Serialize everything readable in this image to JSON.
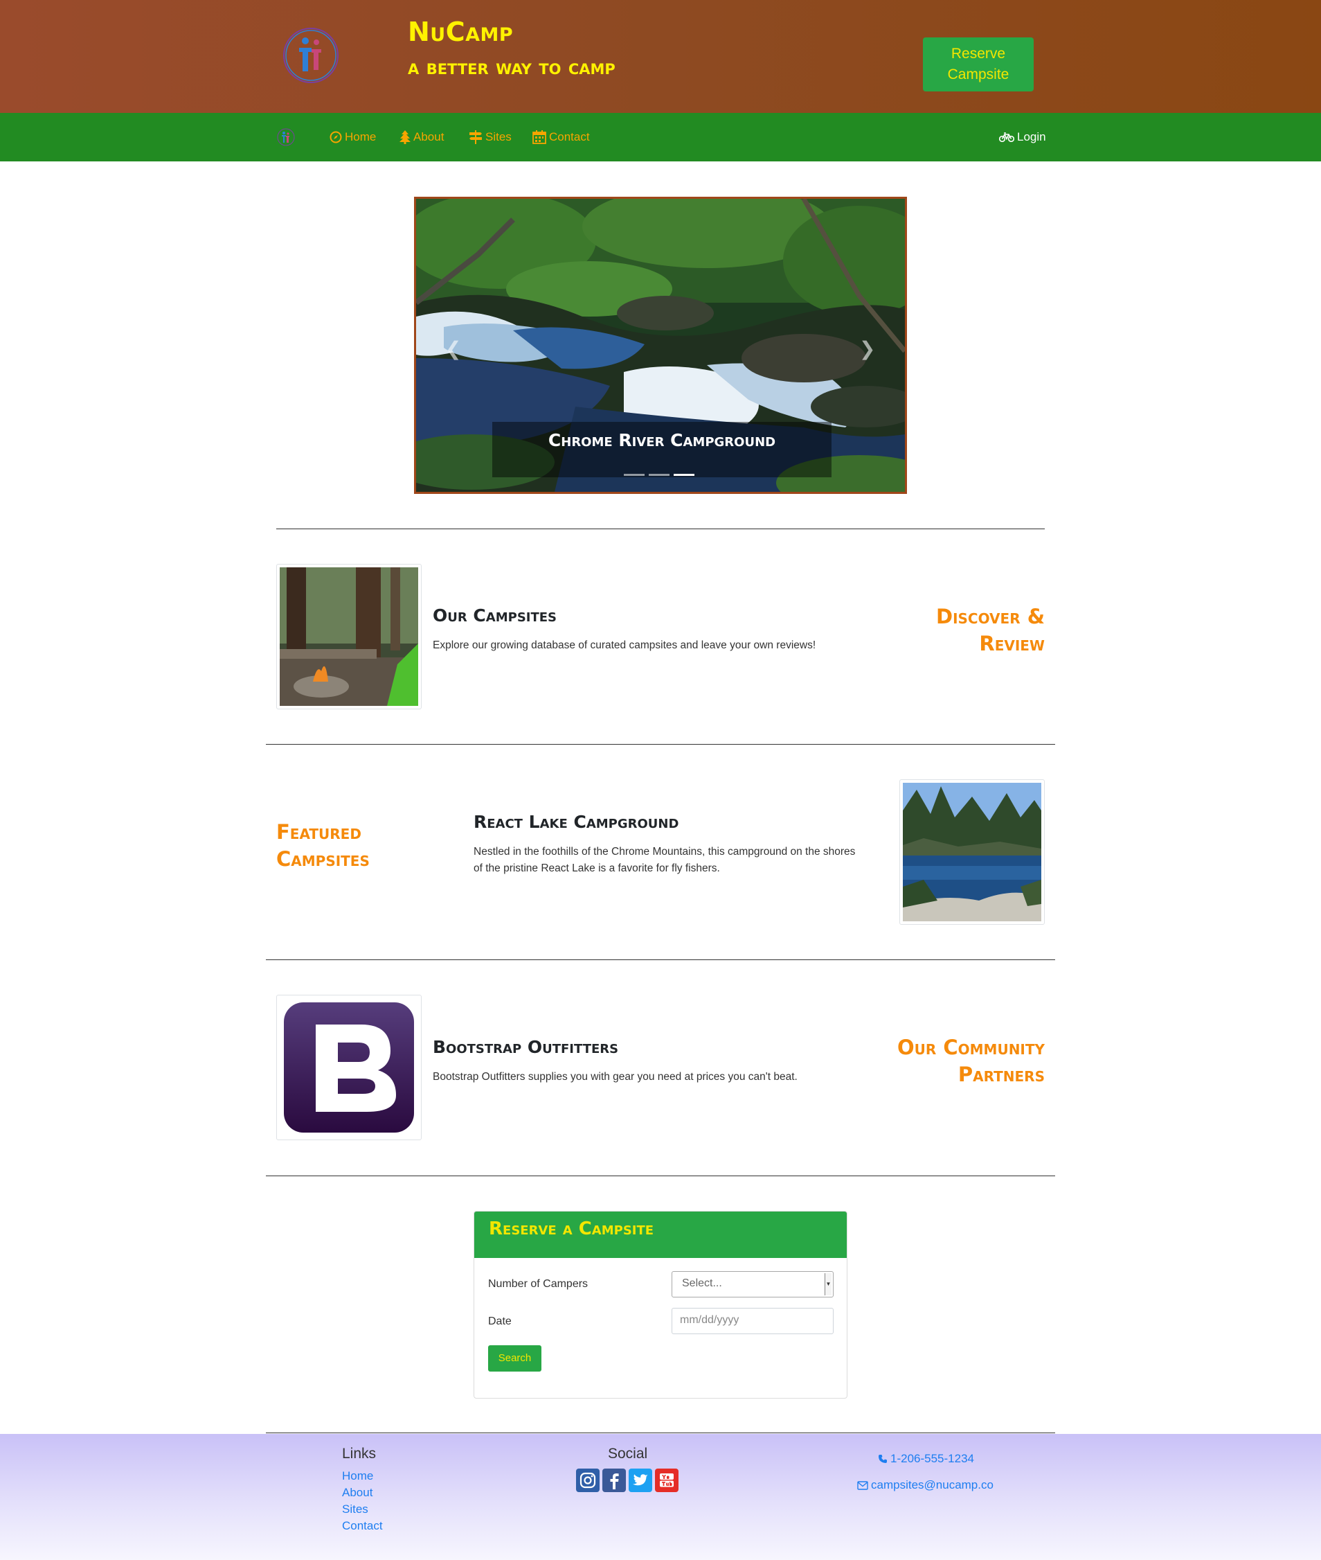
{
  "header": {
    "brand_title": "NuCamp",
    "brand_subtitle": "a better way to camp",
    "reserve_button": "Reserve\nCampsite"
  },
  "nav": {
    "items": [
      {
        "label": "Home",
        "icon": "compass-icon"
      },
      {
        "label": "About",
        "icon": "tree-icon"
      },
      {
        "label": "Sites",
        "icon": "signs-icon"
      },
      {
        "label": "Contact",
        "icon": "calendar-icon"
      }
    ],
    "login": "Login",
    "login_icon": "bicycle-icon"
  },
  "carousel": {
    "caption": "Chrome River Campground",
    "slide_count": 3,
    "active_slide": 3
  },
  "sections": [
    {
      "title": "Our Campsites",
      "text": "Explore our growing database of curated campsites and leave your own reviews!",
      "side_heading_1": "Discover &",
      "side_heading_2": "Review"
    },
    {
      "title": "React Lake Campground",
      "text_1": "Nestled in the foothills of the Chrome Mountains, this campground on the shores",
      "text_2": "of the pristine React Lake is a favorite for fly fishers.",
      "side_heading_1": "Featured",
      "side_heading_2": "Campsites"
    },
    {
      "title": "Bootstrap Outfitters",
      "text": "Bootstrap Outfitters supplies you with gear you need at prices you can't beat.",
      "side_heading_1": "Our Community",
      "side_heading_2": "Partners"
    }
  ],
  "reserve_form": {
    "title": "Reserve a Campsite",
    "campers_label": "Number of Campers",
    "campers_value": "Select...",
    "date_label": "Date",
    "date_placeholder": "mm/dd/yyyy",
    "search_button": "Search"
  },
  "footer": {
    "links_heading": "Links",
    "links": [
      "Home",
      "About",
      "Sites",
      "Contact"
    ],
    "social_heading": "Social",
    "social": [
      "instagram-icon",
      "facebook-icon",
      "twitter-icon",
      "youtube-icon"
    ],
    "phone": "1-206-555-1234",
    "email": "campsites@nucamp.co"
  },
  "colors": {
    "header_bg": "#8e4a22",
    "nav_bg": "#228b22",
    "brand_yellow": "#fff200",
    "accent_green": "#28a745",
    "orange_heading": "#f58a0b",
    "link_blue": "#1e7ef0",
    "footer_bg": "#d6d0f9"
  }
}
